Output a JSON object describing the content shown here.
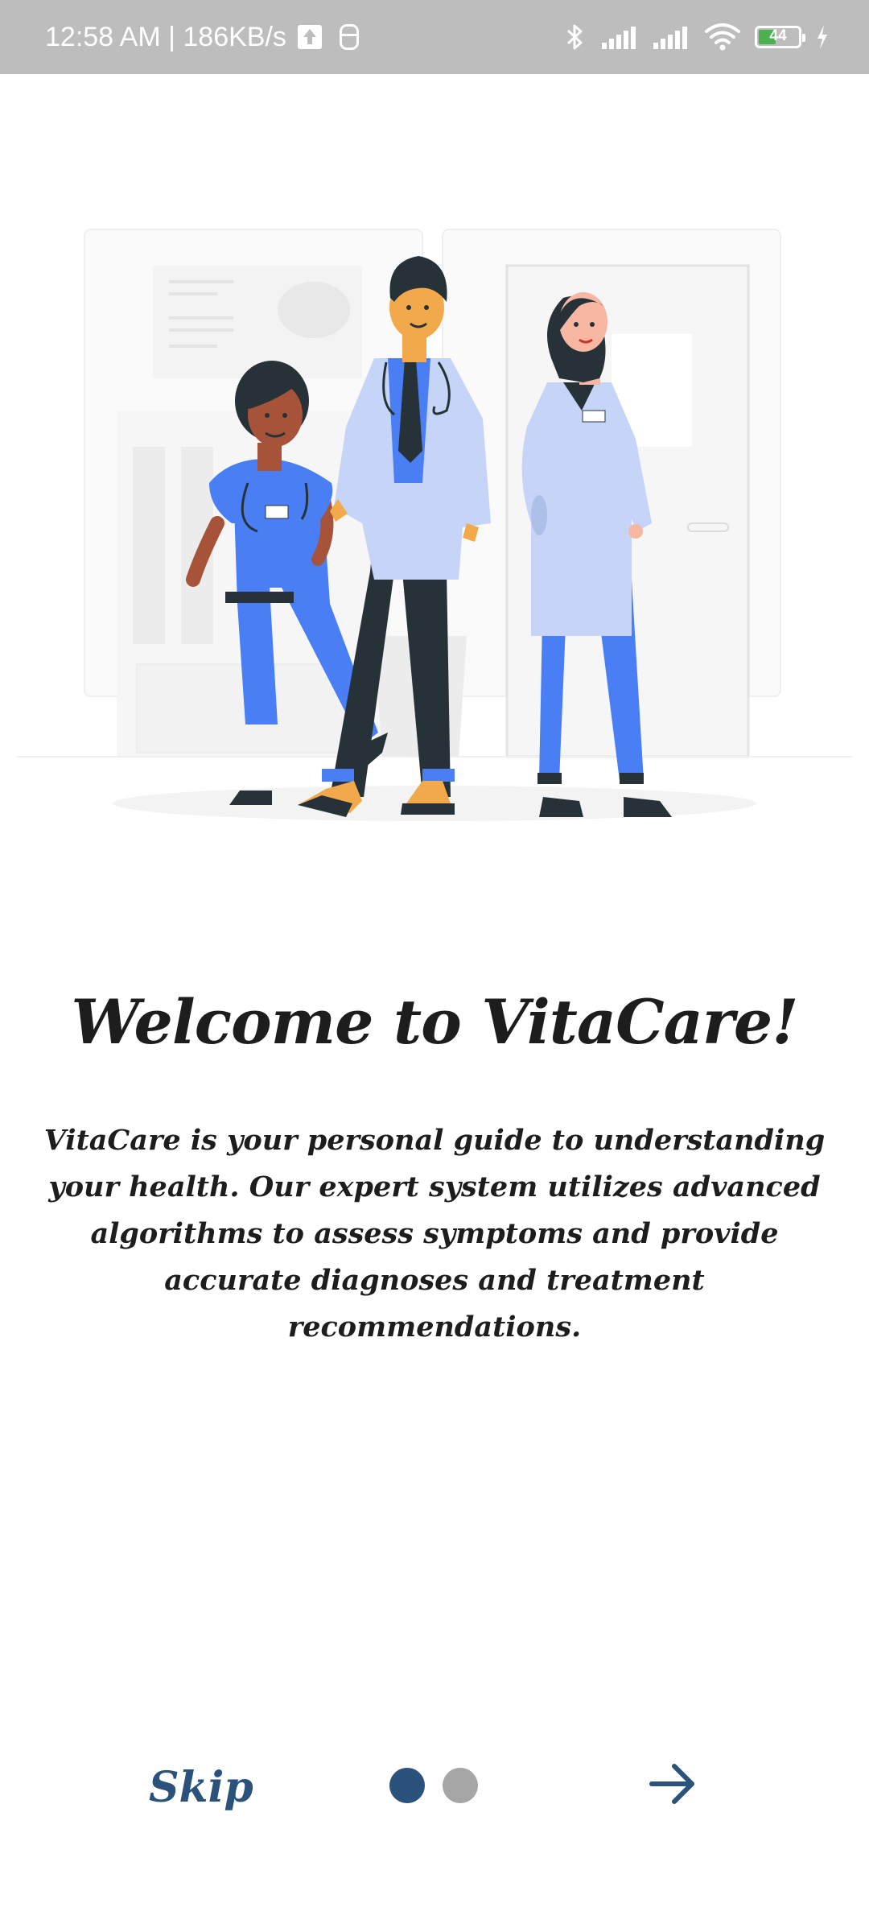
{
  "status_bar": {
    "time_speed": "12:58 AM | 186KB/s",
    "battery_level": "44",
    "battery_fraction": 0.44,
    "icons": [
      "upload-icon",
      "mouse-icon",
      "bluetooth-icon",
      "signal-icon",
      "signal-icon",
      "wifi-icon",
      "battery-icon",
      "charging-icon"
    ]
  },
  "onboarding": {
    "title": "Welcome to VitaCare!",
    "description": "VitaCare is your personal guide to understanding\nyour  health. Our expert system utilizes advanced\nalgorithms to assess symptoms and provide\naccurate diagnoses and treatment\nrecommendations.",
    "skip_label": "Skip",
    "page_count": 2,
    "current_page": 1,
    "next_icon": "arrow-right-icon"
  },
  "colors": {
    "primary": "#2a527a",
    "dot_active": "#2a527a",
    "dot_inactive": "#a6a6a6",
    "text": "#1d1d1d",
    "status_bar": "#bdbdbd",
    "illustration_blue": "#4a7ef5",
    "illustration_light_blue": "#c5d4f7",
    "illustration_dark": "#263238"
  }
}
